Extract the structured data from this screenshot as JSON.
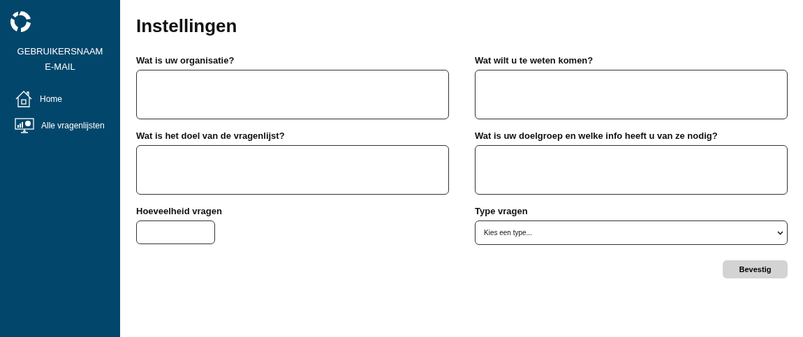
{
  "sidebar": {
    "username": "GEBRUIKERSNAAM",
    "email": "E-MAIL",
    "items": [
      {
        "label": "Home",
        "kind": "home"
      },
      {
        "label": "Alle vragenlijsten",
        "kind": "dashboard"
      }
    ]
  },
  "title": "Instellingen",
  "fields": [
    {
      "label": "Wat is uw organisatie?",
      "kind": "textarea"
    },
    {
      "label": "Wat wilt u te weten komen?",
      "kind": "textarea"
    },
    {
      "label": "Wat is het doel van de vragenlijst?",
      "kind": "textarea"
    },
    {
      "label": "Wat is uw doelgroep en welke info heeft u van ze nodig?",
      "kind": "textarea"
    },
    {
      "label": "Hoeveelheid vragen",
      "kind": "number"
    },
    {
      "label": "Type vragen",
      "kind": "select",
      "value": "Kies een type..."
    }
  ],
  "submit": "Bevestig"
}
